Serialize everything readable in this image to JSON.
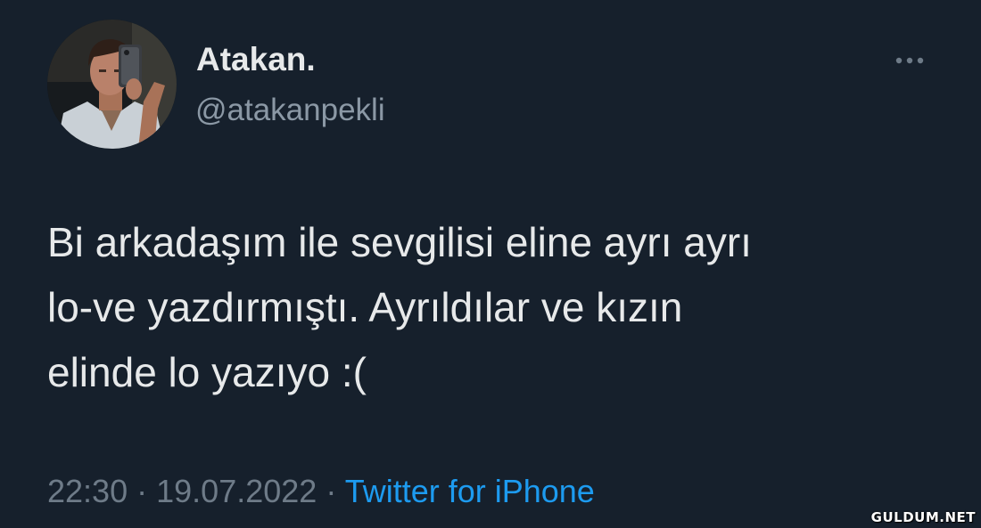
{
  "tweet": {
    "author": {
      "display_name": "Atakan.",
      "handle": "@atakanpekli",
      "avatar_icon": "profile-photo-selfie"
    },
    "more_icon": "more-horizontal-icon",
    "text_lines": [
      "Bi arkadaşım ile sevgilisi eline ayrı ayrı",
      "lo-ve yazdırmıştı. Ayrıldılar ve kızın",
      "elinde lo yazıyo :("
    ],
    "time": "22:30",
    "separator": "·",
    "date": "19.07.2022",
    "source": "Twitter for iPhone"
  },
  "watermark": "GULDUM.NET",
  "colors": {
    "background": "#16202c",
    "primary_text": "#e7e9ea",
    "secondary_text": "#8b98a5",
    "meta_text": "#6e7b88",
    "link": "#1d9bf0"
  }
}
